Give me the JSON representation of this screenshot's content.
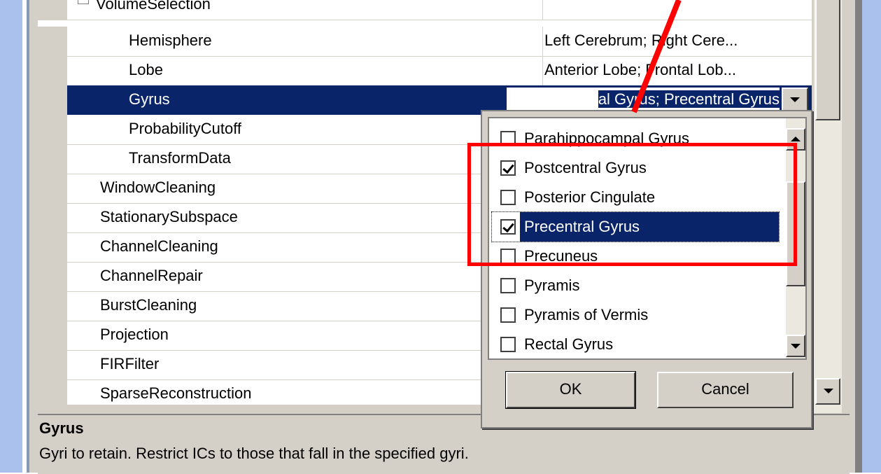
{
  "grid": {
    "rows": [
      {
        "name": "VolumeSelection",
        "value": "",
        "indent": 1,
        "expander": "minus"
      },
      {
        "name": "Hemisphere",
        "value": "Left Cerebrum; Right Cere...",
        "indent": 2
      },
      {
        "name": "Lobe",
        "value": "Anterior Lobe; Frontal Lob...",
        "indent": 2
      },
      {
        "name": "Gyrus",
        "value": "",
        "indent": 2,
        "selected": true
      },
      {
        "name": "ProbabilityCutoff",
        "value": "",
        "indent": 2
      },
      {
        "name": "TransformData",
        "value": "",
        "indent": 2
      },
      {
        "name": "WindowCleaning",
        "value": "",
        "indent": 1
      },
      {
        "name": "StationarySubspace",
        "value": "",
        "indent": 1
      },
      {
        "name": "ChannelCleaning",
        "value": "",
        "indent": 1
      },
      {
        "name": "ChannelRepair",
        "value": "",
        "indent": 1
      },
      {
        "name": "BurstCleaning",
        "value": "",
        "indent": 1
      },
      {
        "name": "Projection",
        "value": "",
        "indent": 1
      },
      {
        "name": "FIRFilter",
        "value": "",
        "indent": 1
      },
      {
        "name": "SparseReconstruction",
        "value": "",
        "indent": 1
      }
    ],
    "editor_value": "al Gyrus; Precentral Gyrus"
  },
  "dropdown": {
    "items": [
      {
        "label": "Parahippocampal Gyrus",
        "checked": false
      },
      {
        "label": "Postcentral Gyrus",
        "checked": true
      },
      {
        "label": "Posterior Cingulate",
        "checked": false
      },
      {
        "label": "Precentral Gyrus",
        "checked": true,
        "highlighted": true
      },
      {
        "label": "Precuneus",
        "checked": false
      },
      {
        "label": "Pyramis",
        "checked": false
      },
      {
        "label": "Pyramis of Vermis",
        "checked": false
      },
      {
        "label": "Rectal Gyrus",
        "checked": false
      }
    ],
    "ok_label": "OK",
    "cancel_label": "Cancel"
  },
  "description": {
    "title": "Gyrus",
    "text": "Gyri to retain.  Restrict ICs to those that fall in the specified gyri."
  },
  "colors": {
    "selection": "#0a246a",
    "annotation": "#ff0000",
    "window_face": "#d4d0c8",
    "desktop": "#a9c1ec"
  }
}
